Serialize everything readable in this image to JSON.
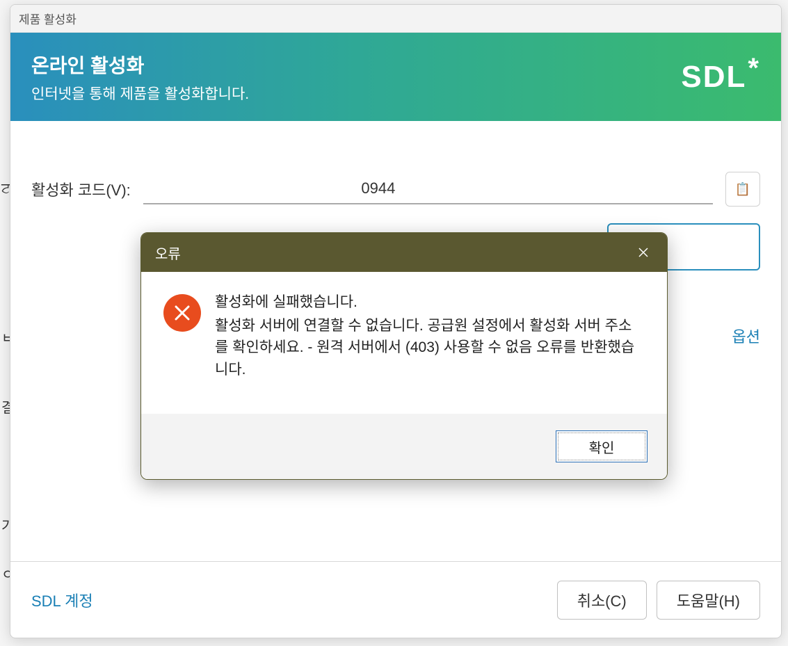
{
  "window_title": "제품 활성화",
  "banner": {
    "title": "온라인 활성화",
    "subtitle": "인터넷을 통해 제품을 활성화합니다.",
    "logo_text": "SDL",
    "logo_star": "*"
  },
  "activation": {
    "code_label": "활성화 코드(V):",
    "code_value": "                                                  0944",
    "paste_icon": "📋"
  },
  "options_link": "옵션",
  "footer": {
    "account_link": "SDL 계정",
    "cancel": "취소(C)",
    "help": "도움말(H)"
  },
  "error_modal": {
    "title": "오류",
    "line1": "활성화에 실패했습니다.",
    "line2": "활성화 서버에 연결할 수 없습니다. 공급원 설정에서 활성화 서버 주소를 확인하세요. - 원격 서버에서 (403) 사용할 수 없음 오류를 반환했습니다.",
    "ok": "확인"
  }
}
